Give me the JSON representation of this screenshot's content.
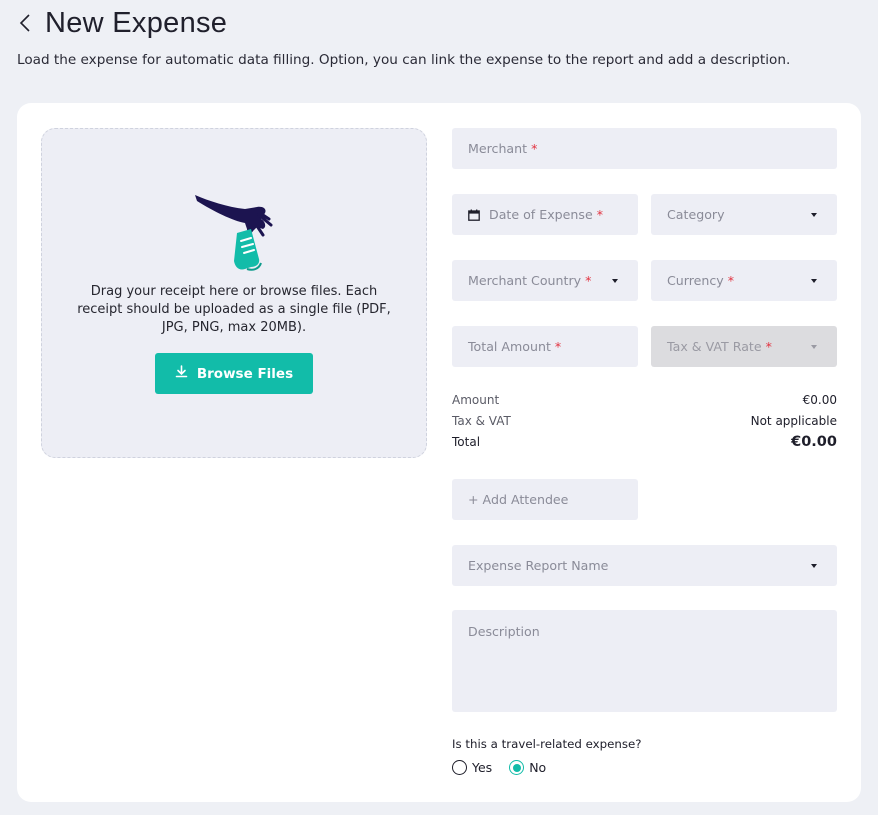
{
  "header": {
    "title": "New Expense",
    "subtitle": "Load the expense for automatic data filling. Option, you can link the expense to the report and add a description."
  },
  "dropzone": {
    "text": "Drag your receipt here or browse files. Each receipt should be uploaded as a single file (PDF, JPG, PNG, max 20MB).",
    "button_label": "Browse Files"
  },
  "form": {
    "merchant": "Merchant",
    "date": "Date of Expense",
    "category": "Category",
    "merchant_country": "Merchant Country",
    "currency": "Currency",
    "total_amount": "Total Amount",
    "tax_rate": "Tax & VAT Rate",
    "required_mark": "*",
    "add_attendee": "+ Add Attendee",
    "report_name": "Expense Report Name",
    "description": "Description"
  },
  "summary": {
    "amount_label": "Amount",
    "amount_value": "€0.00",
    "tax_label": "Tax & VAT",
    "tax_value": "Not applicable",
    "total_label": "Total",
    "total_value": "€0.00"
  },
  "travel": {
    "question": "Is this a travel-related expense?",
    "yes_label": "Yes",
    "no_label": "No",
    "selected": "No"
  },
  "colors": {
    "accent": "#12bca9",
    "required": "#e2323f",
    "background": "#eef0f5",
    "field": "#edeef5",
    "illustration_dark": "#1c1450"
  }
}
